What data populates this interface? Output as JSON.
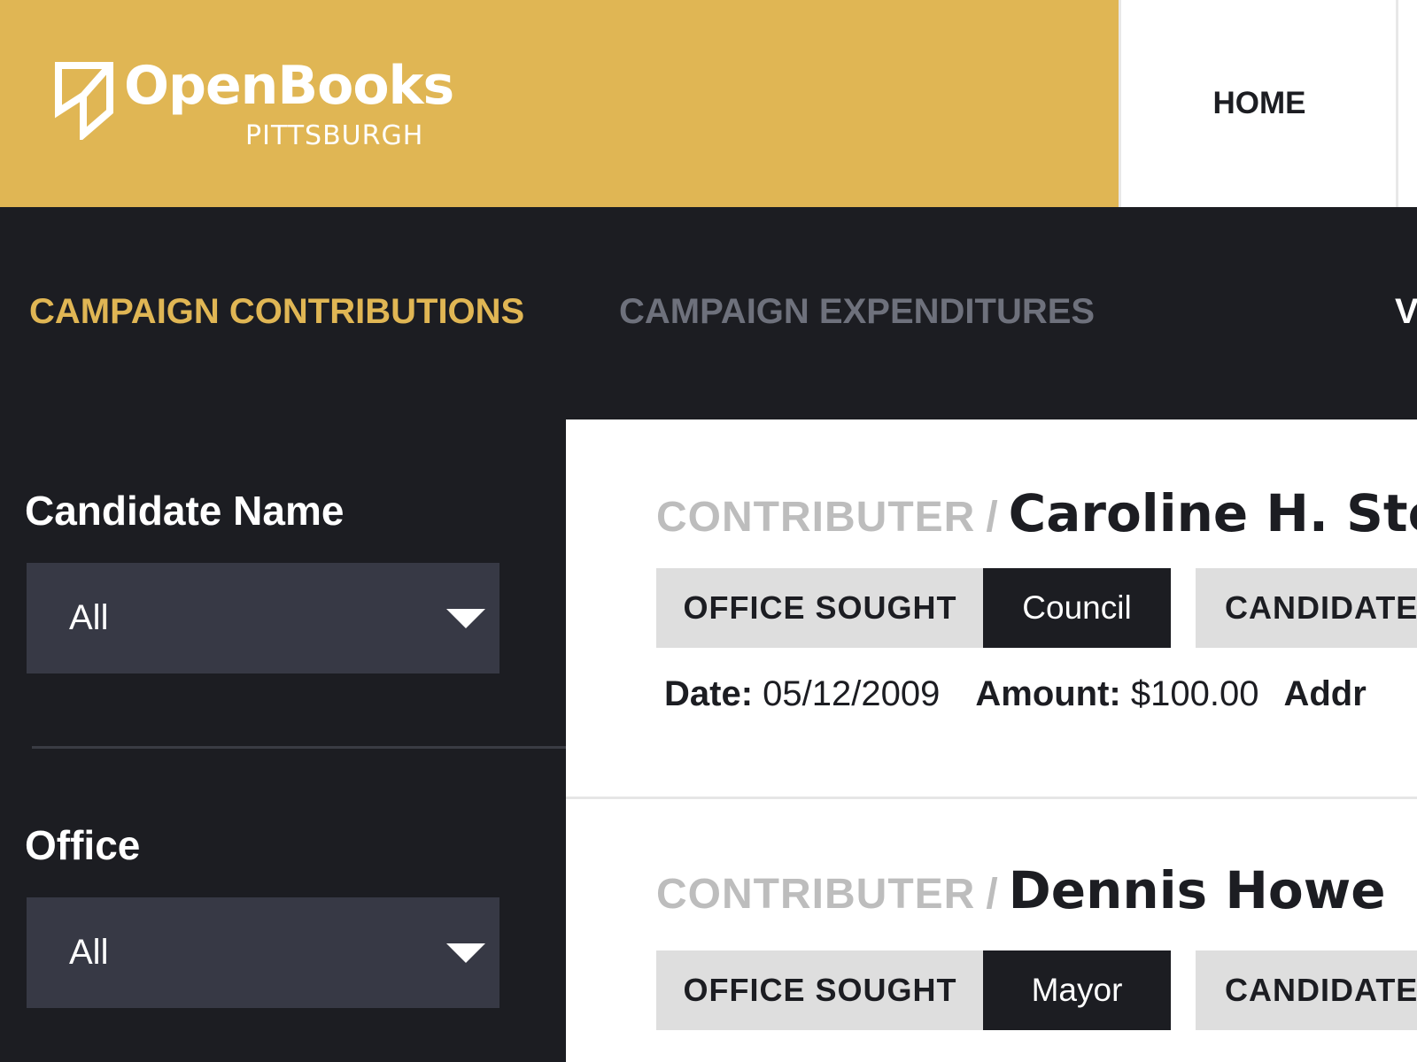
{
  "header": {
    "logo_title": "OpenBooks",
    "logo_subtitle": "PITTSBURGH",
    "nav_home": "HOME"
  },
  "tabs": [
    {
      "label": "CAMPAIGN CONTRIBUTIONS",
      "active": true
    },
    {
      "label": "CAMPAIGN EXPENDITURES",
      "active": false
    },
    {
      "label": "V",
      "active": false
    }
  ],
  "filters": [
    {
      "label": "Candidate Name",
      "value": "All"
    },
    {
      "label": "Office",
      "value": "All"
    }
  ],
  "results": [
    {
      "contributor_label": "CONTRIBUTER",
      "separator": "/",
      "contributor_name": "Caroline H. Ste",
      "office_label": "OFFICE SOUGHT",
      "office_value": "Council",
      "candidate_label": "CANDIDATE",
      "date_label": "Date:",
      "date_value": "05/12/2009",
      "amount_label": "Amount:",
      "amount_value": "$100.00",
      "address_label": "Addr"
    },
    {
      "contributor_label": "CONTRIBUTER",
      "separator": "/",
      "contributor_name": "Dennis Howe",
      "office_label": "OFFICE SOUGHT",
      "office_value": "Mayor",
      "candidate_label": "CANDIDATE"
    }
  ],
  "colors": {
    "brand": "#e0b654",
    "dark": "#1c1d22",
    "select_bg": "#373945",
    "tab_inactive": "#6e717c"
  }
}
